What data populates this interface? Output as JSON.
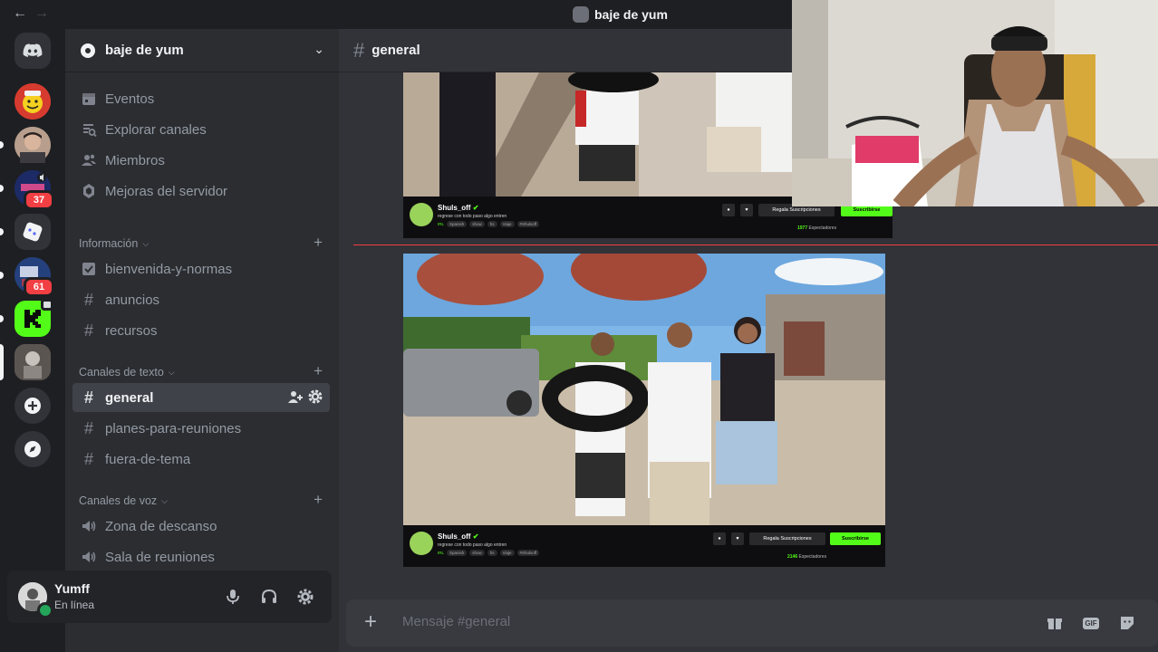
{
  "window": {
    "title": "baje de yum",
    "back_icon": "arrow-left-icon",
    "forward_icon": "arrow-right-icon"
  },
  "server_rail": {
    "badges": [
      "37",
      "61"
    ],
    "add_server_icon": "plus-icon",
    "discover_icon": "compass-icon"
  },
  "server": {
    "name": "baje de yum"
  },
  "nav_links": [
    {
      "label": "Eventos",
      "icon": "calendar-icon"
    },
    {
      "label": "Explorar canales",
      "icon": "browse-channels-icon"
    },
    {
      "label": "Miembros",
      "icon": "members-icon"
    },
    {
      "label": "Mejoras del servidor",
      "icon": "boost-icon"
    }
  ],
  "categories": {
    "info": {
      "label": "Información",
      "channels": [
        "bienvenida-y-normas",
        "anuncios",
        "recursos"
      ]
    },
    "text": {
      "label": "Canales de texto",
      "channels": [
        "general",
        "planes-para-reuniones",
        "fuera-de-tema"
      ]
    },
    "voice": {
      "label": "Canales de voz",
      "channels": [
        "Zona de descanso",
        "Sala de reuniones"
      ]
    }
  },
  "active_channel": "general",
  "user": {
    "name": "Yumff",
    "status": "En línea"
  },
  "chat": {
    "channel": "general",
    "placeholder": "Mensaje #general",
    "embeds": [
      {
        "channel_name": "Shuls_off",
        "stream_title": "regrese con todo paso algo entren",
        "tags": [
          "IRL",
          "Spanish",
          "show",
          "hs",
          "Viaje",
          "#Shulsoff"
        ],
        "btn_gift": "Regala Suscripciones",
        "btn_sub": "Suscribirse",
        "viewers": "1977",
        "viewers_label": "Espectadores"
      },
      {
        "channel_name": "Shuls_off",
        "stream_title": "regrese con todo paso algo entren",
        "tags": [
          "IRL",
          "Spanish",
          "show",
          "hs",
          "Viaje",
          "#Shulsoff"
        ],
        "btn_gift": "Regala Suscripciones",
        "btn_sub": "Suscribirse",
        "viewers": "2146",
        "viewers_label": "Espectadores"
      }
    ]
  },
  "composer_icons": {
    "gift": "gift-icon",
    "gif": "GIF",
    "sticker": "sticker-icon"
  },
  "colors": {
    "accent_green": "#53fc18",
    "danger": "#f23f43",
    "online": "#23a55a"
  }
}
